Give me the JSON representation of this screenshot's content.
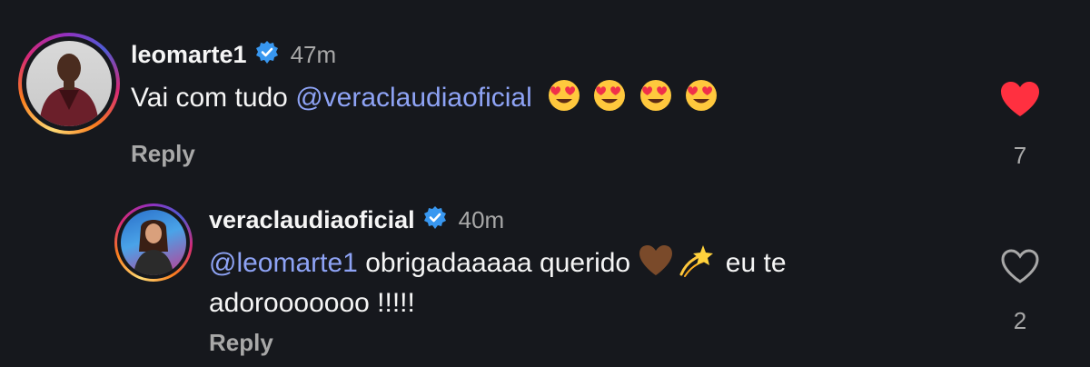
{
  "comments": [
    {
      "username": "leomarte1",
      "verified": true,
      "time": "47m",
      "text_before_mention": "Vai com tudo ",
      "mention": "@veraclaudiaoficial",
      "emojis": [
        "smiling-face-with-heart-eyes",
        "smiling-face-with-heart-eyes",
        "smiling-face-with-heart-eyes",
        "smiling-face-with-heart-eyes"
      ],
      "reply_label": "Reply",
      "liked": true,
      "like_count": "7"
    },
    {
      "username": "veraclaudiaoficial",
      "verified": true,
      "time": "40m",
      "mention": "@leomarte1",
      "text_line1_part1": " obrigadaaaaa querido ",
      "emojis": [
        "brown-heart",
        "dizzy"
      ],
      "text_line1_part2": " eu te",
      "text_line2": "adorooooooo !!!!!",
      "reply_label": "Reply",
      "liked": false,
      "like_count": "2"
    }
  ],
  "colors": {
    "background": "#16181d",
    "mention": "#8ea3f5",
    "like_active": "#ff3040",
    "secondary_text": "#a8a8a8",
    "verified_badge": "#3897f0"
  }
}
